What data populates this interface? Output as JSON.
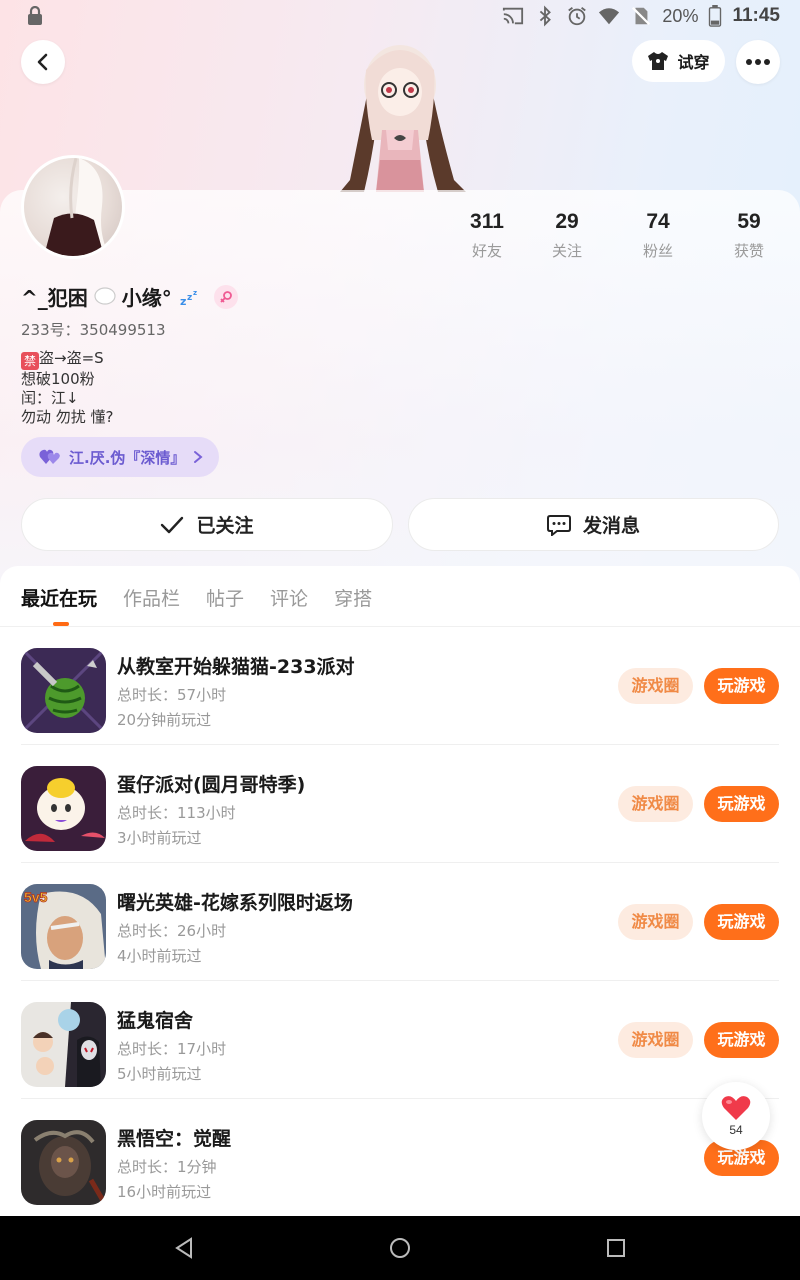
{
  "status_bar": {
    "battery": "20%",
    "time": "11:45",
    "icons": [
      "lock-icon",
      "cast-icon",
      "bluetooth-icon",
      "alarm-icon",
      "wifi-icon",
      "no-sim-icon",
      "battery-icon"
    ]
  },
  "header": {
    "back_icon": "chevron-left-icon",
    "try_on_label": "试穿",
    "more_icon": "more-dots-icon"
  },
  "profile": {
    "username_prefix": "^_犯困",
    "username_suffix": "小缘°",
    "uid": "233号：350499513",
    "bio_badge": "禁",
    "bio_lines": [
      "盗→盗=S",
      "想破100粉",
      "闰：江↓",
      "勿动 勿扰 懂?"
    ],
    "cp_label": "江.厌.伪『深情』",
    "follow_label": "已关注",
    "message_label": "发消息"
  },
  "stats": [
    {
      "value": "311",
      "label": "好友"
    },
    {
      "value": "29",
      "label": "关注"
    },
    {
      "value": "74",
      "label": "粉丝"
    },
    {
      "value": "59",
      "label": "获赞"
    }
  ],
  "tabs": [
    "最近在玩",
    "作品栏",
    "帖子",
    "评论",
    "穿搭"
  ],
  "games": [
    {
      "title": "从教室开始躲猫猫-233派对",
      "duration": "总时长：57小时",
      "last_played": "20分钟前玩过",
      "circle_label": "游戏圈",
      "play_label": "玩游戏"
    },
    {
      "title": "蛋仔派对(圆月哥特季)",
      "duration": "总时长：113小时",
      "last_played": "3小时前玩过",
      "circle_label": "游戏圈",
      "play_label": "玩游戏"
    },
    {
      "title": "曙光英雄-花嫁系列限时返场",
      "duration": "总时长：26小时",
      "last_played": "4小时前玩过",
      "circle_label": "游戏圈",
      "play_label": "玩游戏",
      "icon_text": "5v5"
    },
    {
      "title": "猛鬼宿舍",
      "duration": "总时长：17小时",
      "last_played": "5小时前玩过",
      "circle_label": "游戏圈",
      "play_label": "玩游戏"
    },
    {
      "title": "黑悟空：觉醒",
      "duration": "总时长：1分钟",
      "last_played": "16小时前玩过",
      "play_label": "玩游戏"
    }
  ],
  "like_float": {
    "count": "54"
  },
  "colors": {
    "accent": "#ff6f1a",
    "circle_bg": "#fdebe0",
    "circle_text": "#f08a46",
    "cp_chip": "#e6dcf8"
  }
}
